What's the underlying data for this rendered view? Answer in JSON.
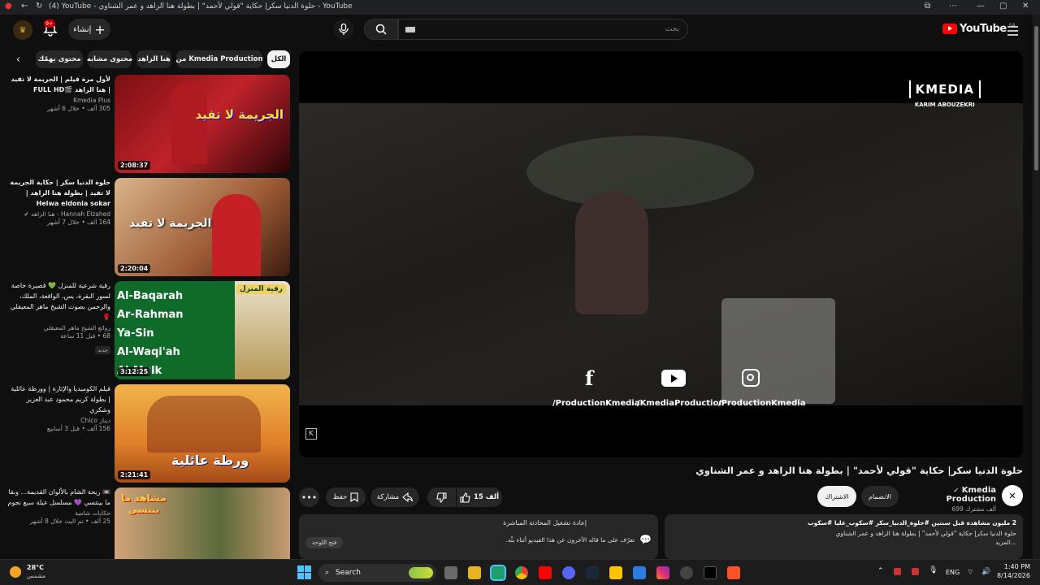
{
  "browser": {
    "title": "(4) YouTube - حلوة الدنيا سكر| حكاية \"قولي لأحمد\" | بطولة هنا الزاهد و عمر الشناوي - YouTube"
  },
  "header": {
    "logo": "YouTube",
    "country": "SA",
    "search_placeholder": "بحث",
    "create_label": "إنشاء",
    "notif_count": "9+"
  },
  "chips": [
    "الكل",
    "من Kmedia Production",
    "هنا الزاهد",
    "محتوى مشابه",
    "محتوى يهمّك"
  ],
  "sidebar": [
    {
      "title": "لأول مرة فيلم | الجريمة لا تفيد | هنا الزاهد 🎬FULL HD",
      "channel": "Kmedia Plus",
      "views": "305 ألف",
      "age": "خلال 6 أشهر",
      "duration": "2:08:37",
      "thumb_text": "الجريمة لا تفيد",
      "new": ""
    },
    {
      "title": "حلوة الدنيا سكر | حكاية الجريمة لا تفيد | بطولة هنا الزاهد | Helwa eldonia sokar",
      "channel": "Hannah Elzahed - هنا الزاهد",
      "views": "164 ألف",
      "age": "خلال 7 أشهر",
      "duration": "2:20:04",
      "thumb_text": "الجريمة لا تفيد",
      "new": ""
    },
    {
      "title": "رقية شرعية للمنزل 💚 قصيرة خاصة لسور البقرة، يس، الواقعة، الملك، والرحمن بصوت الشيخ ماهر المعيقلي 🌹",
      "channel": "روائع الشيخ ماهر المعيقلي",
      "views": "68",
      "age": "قبل 11 ساعة",
      "duration": "3:12:25",
      "thumb_text": "رقية المنزل",
      "new": "جديد"
    },
    {
      "title": "فيلم الكوميديا والإثارة | وورطة عائلية | بطولة كريم محمود عبد العزيز وشكري",
      "channel": "ديناز Chico",
      "views": "156 ألف",
      "age": "قبل 3 أسابيع",
      "duration": "2:21:41",
      "thumb_text": "ورطة عائلية",
      "new": ""
    },
    {
      "title": "📼 ريحة الشام بالألوان القديمة... وبقا ما بينتسي 💜 مسلسل عيلة سبع نجوم",
      "channel": "حكايات شامية",
      "views": "25 ألف",
      "age": "تم البث خلال 8 أشهر",
      "duration": "",
      "thumb_text": "مشاهد ما بتنسى",
      "new": ""
    }
  ],
  "quran_lines": [
    "Al-Baqarah",
    "Ar-Rahman",
    "Ya-Sin",
    "Al-Waqi'ah",
    "Al-Mulk"
  ],
  "player": {
    "brand_line1": "KMEDIA",
    "brand_line2": "KARIM ABOUZEKRI",
    "socials": [
      "/ProductionKmedia",
      "/KmediaProduction",
      "/ProductionKmedia"
    ]
  },
  "video": {
    "title": "حلوة الدنيا سكر| حكاية \"قولي لأحمد\" | بطولة هنا الزاهد و عمر الشناوي",
    "channel": "Kmedia Production",
    "subs": "699 ألف مشترك",
    "join": "الانضمام",
    "subscribe": "الاشتراك",
    "likes": "15 ألف",
    "share": "مشاركة",
    "save": "حفظ",
    "desc_line1": "2 مليون مشاهدة  قبل سنتين  #حلوة_الدنيا_سكر #سكوب_عليا #سكوب",
    "desc_line2": "حلوة الدنيا سكر| حكاية \"قولي لأحمد\" | بطولة هنا الزاهد و عمر الشناوي",
    "desc_more": "...المزيد",
    "chat_title": "إعادة تشغيل المحادثة المباشرة",
    "chat_text": "تعرّف على ما قاله الآخرون عن هذا الفيديو أثناء بثّه.",
    "chat_open": "فتح اللوحة"
  },
  "taskbar": {
    "temp": "28°C",
    "weather": "مشمس",
    "search": "Search",
    "lang": "ENG",
    "time": "1:40 PM",
    "date": "8/14/2026"
  }
}
